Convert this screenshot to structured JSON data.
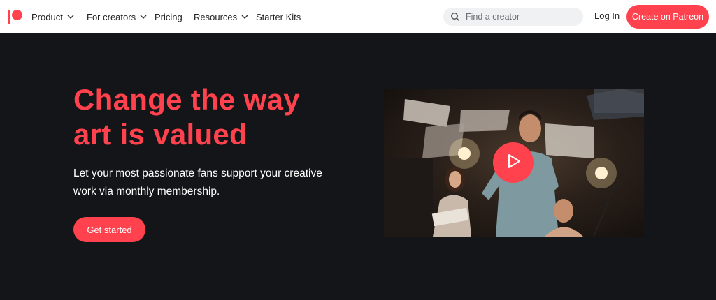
{
  "nav": {
    "items": [
      {
        "label": "Product",
        "has_dropdown": true
      },
      {
        "label": "For creators",
        "has_dropdown": true
      },
      {
        "label": "Pricing",
        "has_dropdown": false
      },
      {
        "label": "Resources",
        "has_dropdown": true
      },
      {
        "label": "Starter Kits",
        "has_dropdown": false
      }
    ],
    "search_placeholder": "Find a creator",
    "login_label": "Log In",
    "cta_label": "Create on Patreon"
  },
  "hero": {
    "title_line1": "Change the way",
    "title_line2": "art is valued",
    "subtitle_line1": "Let your most passionate fans support your creative",
    "subtitle_line2": "work via monthly membership.",
    "button_label": "Get started"
  },
  "colors": {
    "brand": "#ff424d",
    "background": "#141518",
    "nav_background": "#ffffff"
  }
}
